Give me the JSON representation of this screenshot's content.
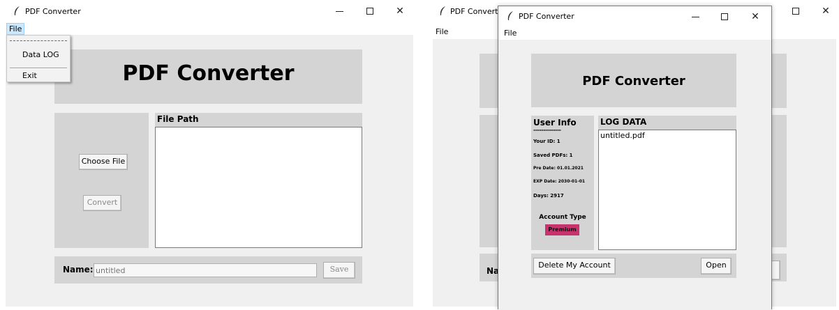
{
  "app_title": "PDF Converter",
  "main_window": {
    "title": "PDF Converter",
    "menu": {
      "file_label": "File",
      "dropdown": [
        "Data LOG",
        "Exit"
      ]
    },
    "heading": "PDF Converter",
    "file_path_label": "File Path",
    "choose_file_button": "Choose File",
    "convert_button": "Convert",
    "name_label": "Name:",
    "name_placeholder": "untitled",
    "save_button": "Save"
  },
  "back_window": {
    "title": "PDF Converte",
    "menu_file": "File",
    "name_label_fragment": "Na"
  },
  "log_window": {
    "title": "PDF Converter",
    "menu_file": "File",
    "heading": "PDF Converter",
    "user_info": {
      "title": "User Info",
      "separator": "--------------",
      "your_id": "Your ID: 1",
      "saved_pdfs": "Saved PDFs: 1",
      "pre_date": "Pre Date: 01.01.2021",
      "exp_date": "EXP Date: 2030-01-01",
      "days": "Days: 2917",
      "account_type_label": "Account Type",
      "account_type_value": "Premium"
    },
    "log_data_title": "LOG DATA",
    "log_entries": [
      "untitled.pdf"
    ],
    "delete_button": "Delete My Account",
    "open_button": "Open"
  },
  "colors": {
    "panel": "#d4d4d4",
    "client": "#f0f0f0",
    "premium_badge": "#c8336e",
    "menu_highlight": "#cce8ff"
  },
  "window_controls": [
    "minimize-icon",
    "maximize-icon",
    "close-icon"
  ]
}
